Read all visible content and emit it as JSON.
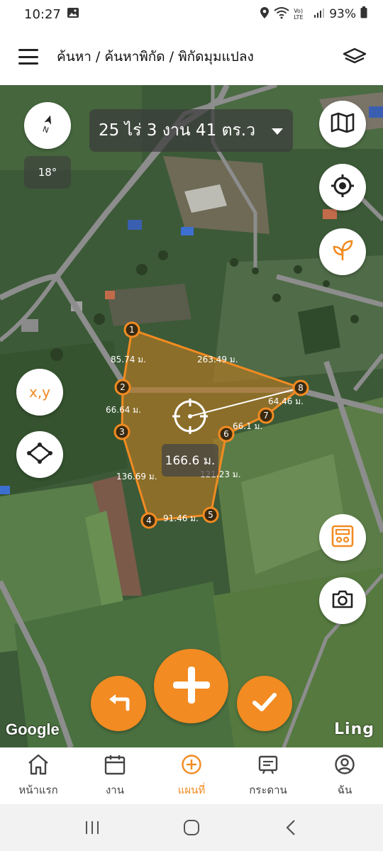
{
  "status_bar": {
    "time": "10:27",
    "battery": "93%",
    "network": "Vo) LTE"
  },
  "header": {
    "breadcrumb": "ค้นหา / ค้นหาพิกัด / พิกัดมุมแปลง"
  },
  "map": {
    "area_text": "25 ไร่ 3 งาน 41 ตร.ว",
    "compass_angle": "18°",
    "xy_label": "x,y",
    "center_distance": "166.6 ม.",
    "google_label": "Google",
    "ling_label": "Ling",
    "vertices": [
      "1",
      "2",
      "3",
      "4",
      "5",
      "6",
      "7",
      "8"
    ],
    "edge_labels": {
      "e12": "85.74 ม.",
      "e23": "66.64 ม.",
      "e34": "136.69 ม.",
      "e45": "91.46 ม.",
      "e56": "121.23 ม.",
      "e67": "66.1 ม.",
      "e78": "64.46 ม.",
      "e81": "263.49 ม."
    }
  },
  "bottom_nav": [
    {
      "label": "หน้าแรก",
      "icon": "home-icon",
      "active": false
    },
    {
      "label": "งาน",
      "icon": "calendar-icon",
      "active": false
    },
    {
      "label": "แผนที่",
      "icon": "plus-circle-icon",
      "active": true
    },
    {
      "label": "กระดาน",
      "icon": "board-icon",
      "active": false
    },
    {
      "label": "ฉัน",
      "icon": "user-icon",
      "active": false
    }
  ],
  "colors": {
    "accent": "#f28b22",
    "polygon_fill": "#b57a22"
  }
}
